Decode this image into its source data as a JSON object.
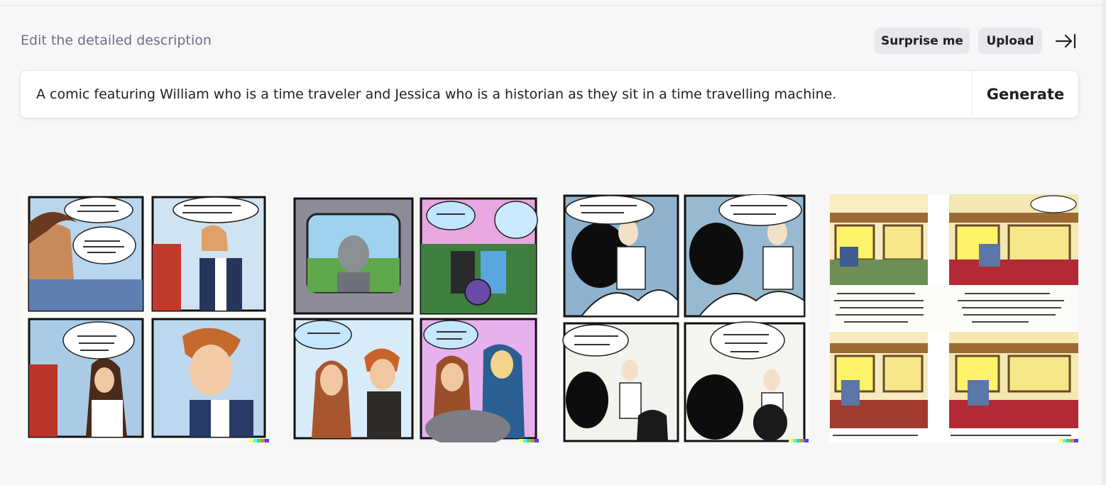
{
  "editor": {
    "hint": "Edit the detailed description",
    "surprise_label": "Surprise me",
    "upload_label": "Upload",
    "collapse_icon": "arrow-right-to-bar-icon",
    "prompt_value": "A comic featuring William who is a time traveler and Jessica who is a historian as they sit in a time travelling machine.",
    "generate_label": "Generate"
  },
  "results": {
    "count": 4,
    "signature_colors": [
      "#ffff66",
      "#42ffff",
      "#51da4c",
      "#ff6e3c",
      "#3c46ff"
    ]
  }
}
